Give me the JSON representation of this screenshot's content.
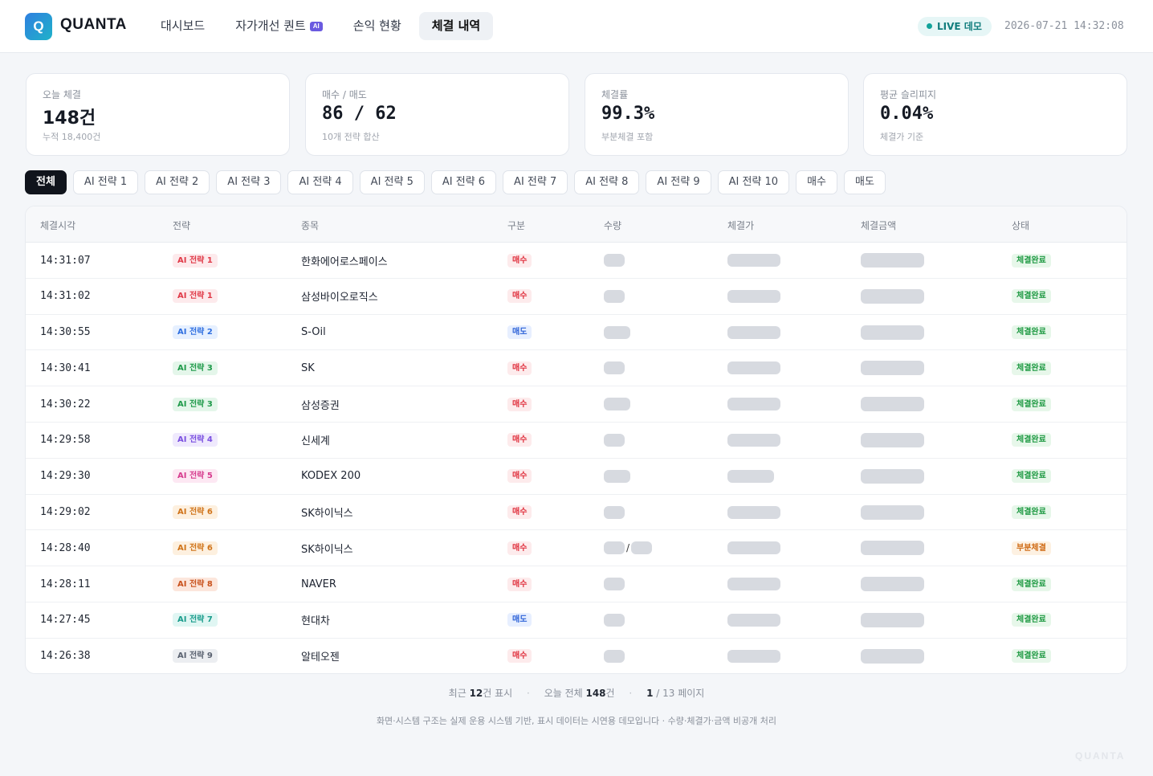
{
  "app": {
    "logo_letter": "Q",
    "name": "QUANTA"
  },
  "nav": [
    {
      "label": "대시보드",
      "active": false,
      "badge": ""
    },
    {
      "label": "자가개선 퀀트",
      "active": false,
      "badge": "AI"
    },
    {
      "label": "손익 현황",
      "active": false,
      "badge": ""
    },
    {
      "label": "체결 내역",
      "active": true,
      "badge": ""
    }
  ],
  "header": {
    "live_label": "LIVE 데모",
    "timestamp": "2026-07-21 14:32:08"
  },
  "stats": [
    {
      "label": "오늘 체결",
      "value": "148건",
      "sub": "누적 18,400건"
    },
    {
      "label": "매수 / 매도",
      "value": "86 / 62",
      "sub": "10개 전략 합산"
    },
    {
      "label": "체결률",
      "value": "99.3%",
      "sub": "부분체결 포함"
    },
    {
      "label": "평균 슬리피지",
      "value": "0.04%",
      "sub": "체결가 기준"
    }
  ],
  "filters": [
    "전체",
    "AI 전략 1",
    "AI 전략 2",
    "AI 전략 3",
    "AI 전략 4",
    "AI 전략 5",
    "AI 전략 6",
    "AI 전략 7",
    "AI 전략 8",
    "AI 전략 9",
    "AI 전략 10",
    "매수",
    "매도"
  ],
  "active_filter": "전체",
  "table": {
    "columns": [
      "체결시각",
      "전략",
      "종목",
      "구분",
      "수량",
      "체결가",
      "체결금액",
      "상태"
    ],
    "strategy_colors": {
      "AI 전략 1": {
        "bg": "#fdeaec",
        "fg": "#e03a48"
      },
      "AI 전략 2": {
        "bg": "#e6f0ff",
        "fg": "#2f6fe0"
      },
      "AI 전략 3": {
        "bg": "#e4f6ea",
        "fg": "#1f9a4a"
      },
      "AI 전략 4": {
        "bg": "#efe9fd",
        "fg": "#7a4fe0"
      },
      "AI 전략 5": {
        "bg": "#fde8f3",
        "fg": "#d63c8e"
      },
      "AI 전략 6": {
        "bg": "#fdf0df",
        "fg": "#d0741a"
      },
      "AI 전략 7": {
        "bg": "#e0f6f3",
        "fg": "#1a9c8c"
      },
      "AI 전략 8": {
        "bg": "#fce6dc",
        "fg": "#c9521d"
      },
      "AI 전략 9": {
        "bg": "#eceef1",
        "fg": "#5a6270"
      }
    },
    "rows": [
      {
        "time": "14:31:07",
        "strategy": "AI 전략 1",
        "name": "한화에어로스페이스",
        "side": "매수",
        "status": "체결완료"
      },
      {
        "time": "14:31:02",
        "strategy": "AI 전략 1",
        "name": "삼성바이오로직스",
        "side": "매수",
        "status": "체결완료"
      },
      {
        "time": "14:30:55",
        "strategy": "AI 전략 2",
        "name": "S-Oil",
        "side": "매도",
        "status": "체결완료"
      },
      {
        "time": "14:30:41",
        "strategy": "AI 전략 3",
        "name": "SK",
        "side": "매수",
        "status": "체결완료"
      },
      {
        "time": "14:30:22",
        "strategy": "AI 전략 3",
        "name": "삼성증권",
        "side": "매수",
        "status": "체결완료"
      },
      {
        "time": "14:29:58",
        "strategy": "AI 전략 4",
        "name": "신세계",
        "side": "매수",
        "status": "체결완료"
      },
      {
        "time": "14:29:30",
        "strategy": "AI 전략 5",
        "name": "KODEX 200",
        "side": "매수",
        "status": "체결완료"
      },
      {
        "time": "14:29:02",
        "strategy": "AI 전략 6",
        "name": "SK하이닉스",
        "side": "매수",
        "status": "체결완료"
      },
      {
        "time": "14:28:40",
        "strategy": "AI 전략 6",
        "name": "SK하이닉스",
        "side": "매수",
        "status": "부분체결",
        "qty_partial": true
      },
      {
        "time": "14:28:11",
        "strategy": "AI 전략 8",
        "name": "NAVER",
        "side": "매수",
        "status": "체결완료"
      },
      {
        "time": "14:27:45",
        "strategy": "AI 전략 7",
        "name": "현대차",
        "side": "매도",
        "status": "체결완료"
      },
      {
        "time": "14:26:38",
        "strategy": "AI 전략 9",
        "name": "알테오젠",
        "side": "매수",
        "status": "체결완료"
      }
    ]
  },
  "pager": {
    "recent_prefix": "최근 ",
    "recent_count": "12",
    "recent_suffix": "건 표시",
    "total_prefix": "오늘 전체 ",
    "total_count": "148",
    "total_suffix": "건",
    "page_current": "1",
    "page_rest": " / 13 페이지"
  },
  "disclaimer": "화면·시스템 구조는 실제 운용 시스템 기반, 표시 데이터는 시연용 데모입니다 · 수량·체결가·금액 비공개 처리",
  "watermark": "QUANTA"
}
